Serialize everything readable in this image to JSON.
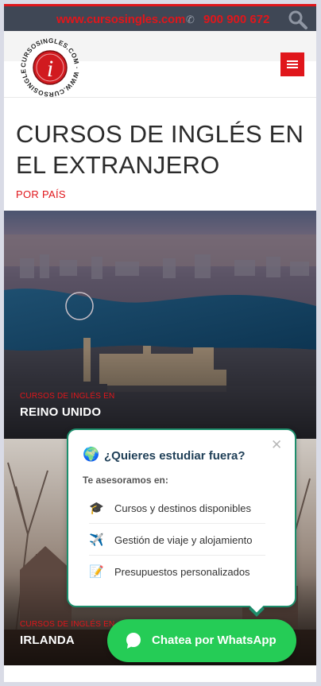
{
  "topbar": {
    "site": "www.cursosingles.com",
    "phone": "900 900 672",
    "phone_icon": "phone-icon",
    "search_icon": "search-icon",
    "accent": "#e0161b",
    "background": "#3f4755"
  },
  "header": {
    "logo_ring_text": "CURSOSINGLES.COM · WWW.CURSOSINGLES.COM ·",
    "logo_letter": "i",
    "menu_icon": "hamburger-icon"
  },
  "page": {
    "title": "CURSOS DE INGLÉS EN EL EXTRANJERO",
    "subtitle": "POR PAÍS"
  },
  "cards": [
    {
      "kicker": "CURSOS DE INGLÉS EN",
      "country": "REINO UNIDO"
    },
    {
      "kicker": "CURSOS DE INGLÉS EN",
      "country": "IRLANDA"
    }
  ],
  "popup": {
    "globe_icon": "globe-icon",
    "question": "¿Quieres estudiar fuera?",
    "lead": "Te asesoramos en:",
    "close_icon": "close-icon",
    "items": [
      {
        "icon": "graduation-cap-icon",
        "glyph": "🎓",
        "text": "Cursos y destinos disponibles"
      },
      {
        "icon": "airplane-icon",
        "glyph": "✈️",
        "text": "Gestión de viaje y alojamiento"
      },
      {
        "icon": "memo-icon",
        "glyph": "📝",
        "text": "Presupuestos personalizados"
      }
    ],
    "border_color": "#1d8e6c"
  },
  "whatsapp": {
    "label": "Chatea por WhatsApp",
    "icon": "whatsapp-icon",
    "color": "#25cc56"
  }
}
